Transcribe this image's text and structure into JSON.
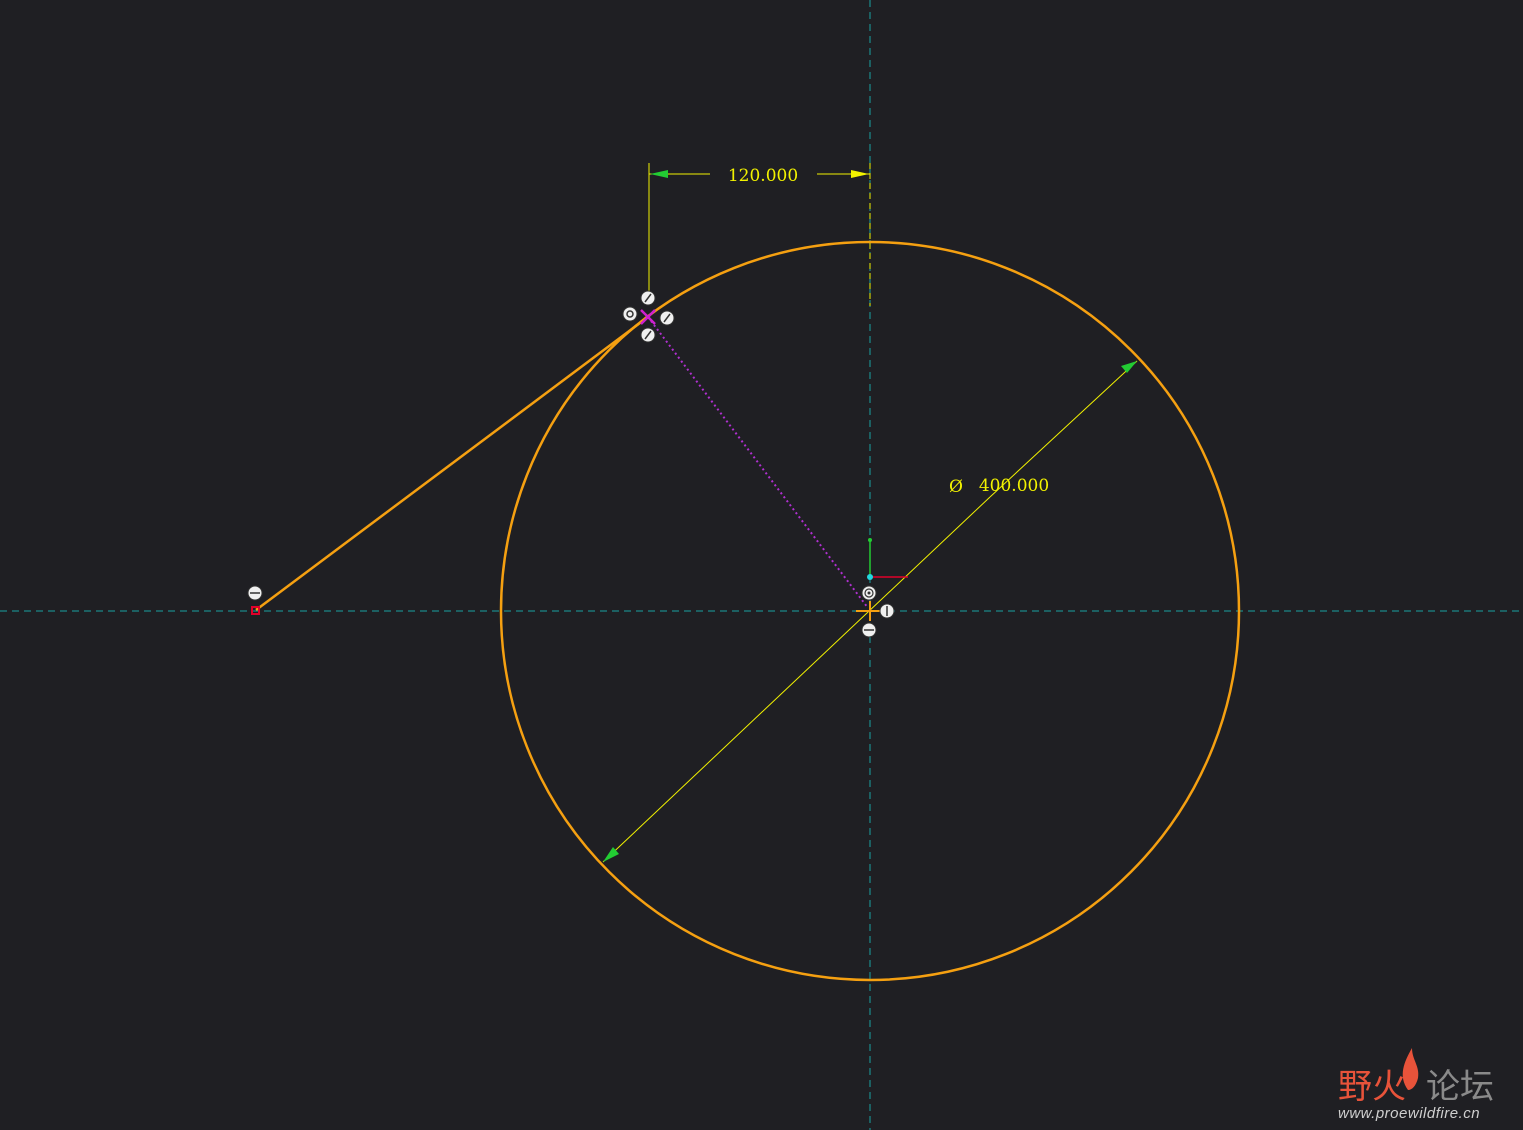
{
  "colors": {
    "background": "#1f1f23",
    "geometry": "#f5a011",
    "centerline": "#1aa0a0",
    "dimension": "#f2f200",
    "arrowhead": "#22cc33",
    "construction": "#b030d0",
    "point_marker": "#e0002a"
  },
  "dimensions": {
    "horizontal_label": "120.000",
    "diameter_symbol": "Ø",
    "diameter_label": "400.000"
  },
  "constraint_icons": [
    "pin-constraint-icon",
    "tangent-constraint-icon",
    "perpendicular-constraint-icon",
    "concentric-constraint-icon",
    "horizontal-constraint-icon",
    "vertical-constraint-icon"
  ],
  "watermark": {
    "title_part1": "野火",
    "title_part2": "论坛",
    "url": "www.proewildfire.cn"
  }
}
